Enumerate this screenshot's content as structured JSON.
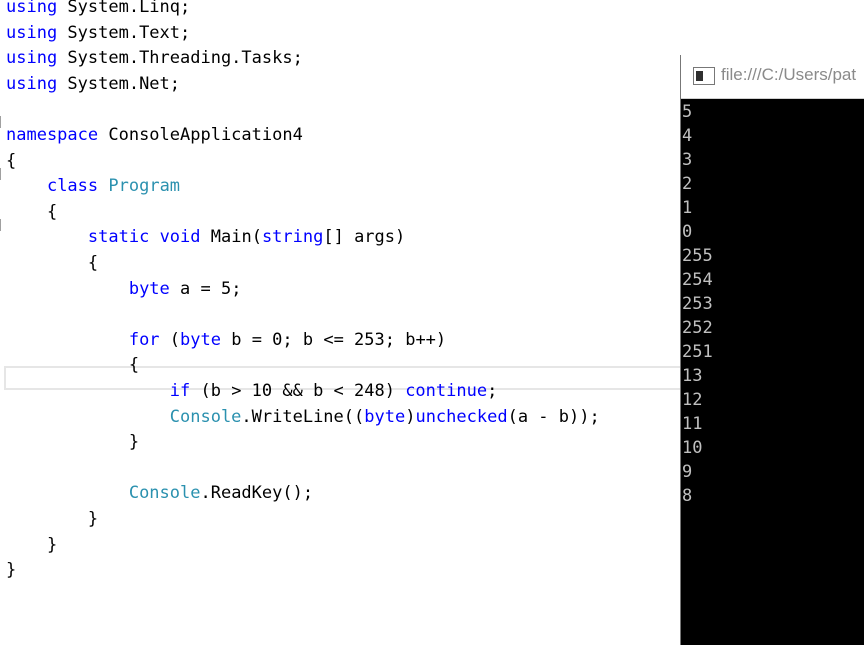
{
  "editor": {
    "lines": [
      {
        "parts": [
          {
            "t": "using",
            "c": "kw"
          },
          {
            "t": " System.Linq;",
            "c": ""
          }
        ]
      },
      {
        "parts": [
          {
            "t": "using",
            "c": "kw"
          },
          {
            "t": " System.Text;",
            "c": ""
          }
        ]
      },
      {
        "parts": [
          {
            "t": "using",
            "c": "kw"
          },
          {
            "t": " System.Threading.Tasks;",
            "c": ""
          }
        ]
      },
      {
        "parts": [
          {
            "t": "using",
            "c": "kw"
          },
          {
            "t": " System.Net;",
            "c": ""
          }
        ]
      },
      {
        "parts": []
      },
      {
        "parts": [
          {
            "t": "namespace",
            "c": "kw"
          },
          {
            "t": " ConsoleApplication4",
            "c": ""
          }
        ]
      },
      {
        "parts": [
          {
            "t": "{",
            "c": ""
          }
        ]
      },
      {
        "parts": [
          {
            "t": "    ",
            "c": ""
          },
          {
            "t": "class",
            "c": "kw"
          },
          {
            "t": " ",
            "c": ""
          },
          {
            "t": "Program",
            "c": "ty"
          }
        ]
      },
      {
        "parts": [
          {
            "t": "    {",
            "c": ""
          }
        ]
      },
      {
        "parts": [
          {
            "t": "        ",
            "c": ""
          },
          {
            "t": "static",
            "c": "kw"
          },
          {
            "t": " ",
            "c": ""
          },
          {
            "t": "void",
            "c": "kw"
          },
          {
            "t": " Main(",
            "c": ""
          },
          {
            "t": "string",
            "c": "kw"
          },
          {
            "t": "[] args)",
            "c": ""
          }
        ]
      },
      {
        "parts": [
          {
            "t": "        {",
            "c": ""
          }
        ]
      },
      {
        "parts": [
          {
            "t": "            ",
            "c": ""
          },
          {
            "t": "byte",
            "c": "kw"
          },
          {
            "t": " a = 5;",
            "c": ""
          }
        ]
      },
      {
        "parts": []
      },
      {
        "parts": [
          {
            "t": "            ",
            "c": ""
          },
          {
            "t": "for",
            "c": "kw"
          },
          {
            "t": " (",
            "c": ""
          },
          {
            "t": "byte",
            "c": "kw"
          },
          {
            "t": " b = 0; b <= 253; b++)",
            "c": ""
          }
        ]
      },
      {
        "parts": [
          {
            "t": "            {",
            "c": ""
          }
        ]
      },
      {
        "parts": [
          {
            "t": "                ",
            "c": ""
          },
          {
            "t": "if",
            "c": "kw"
          },
          {
            "t": " (b > 10 && b < 248) ",
            "c": ""
          },
          {
            "t": "continue",
            "c": "kw"
          },
          {
            "t": ";",
            "c": ""
          }
        ]
      },
      {
        "parts": [
          {
            "t": "                ",
            "c": ""
          },
          {
            "t": "Console",
            "c": "ty"
          },
          {
            "t": ".WriteLine((",
            "c": ""
          },
          {
            "t": "byte",
            "c": "kw"
          },
          {
            "t": ")",
            "c": ""
          },
          {
            "t": "unchecked",
            "c": "kw"
          },
          {
            "t": "(a - b));",
            "c": ""
          }
        ]
      },
      {
        "parts": [
          {
            "t": "            }",
            "c": ""
          }
        ]
      },
      {
        "parts": []
      },
      {
        "parts": [
          {
            "t": "            ",
            "c": ""
          },
          {
            "t": "Console",
            "c": "ty"
          },
          {
            "t": ".ReadKey();",
            "c": ""
          }
        ]
      },
      {
        "parts": [
          {
            "t": "        }",
            "c": ""
          }
        ]
      },
      {
        "parts": [
          {
            "t": "    }",
            "c": ""
          }
        ]
      },
      {
        "parts": [
          {
            "t": "}",
            "c": ""
          }
        ]
      }
    ]
  },
  "console": {
    "title": "file:///C:/Users/pat",
    "output": [
      "5",
      "4",
      "3",
      "2",
      "1",
      "0",
      "255",
      "254",
      "253",
      "252",
      "251",
      "13",
      "12",
      "11",
      "10",
      "9",
      "8"
    ]
  },
  "colors": {
    "keyword": "#0000ff",
    "type": "#2b91af",
    "console_bg": "#000000",
    "console_text": "#c0c0c0"
  }
}
